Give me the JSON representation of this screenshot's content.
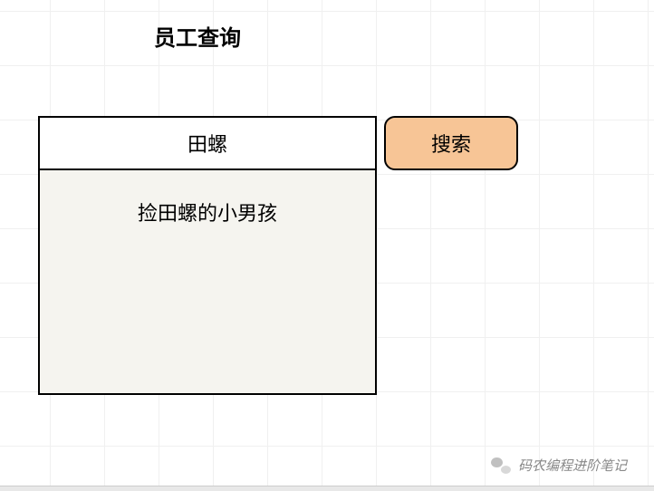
{
  "title": "员工查询",
  "search": {
    "input_value": "田螺",
    "button_label": "搜索"
  },
  "results": {
    "items": [
      "捡田螺的小男孩"
    ]
  },
  "watermark": {
    "text": "码农编程进阶笔记"
  }
}
